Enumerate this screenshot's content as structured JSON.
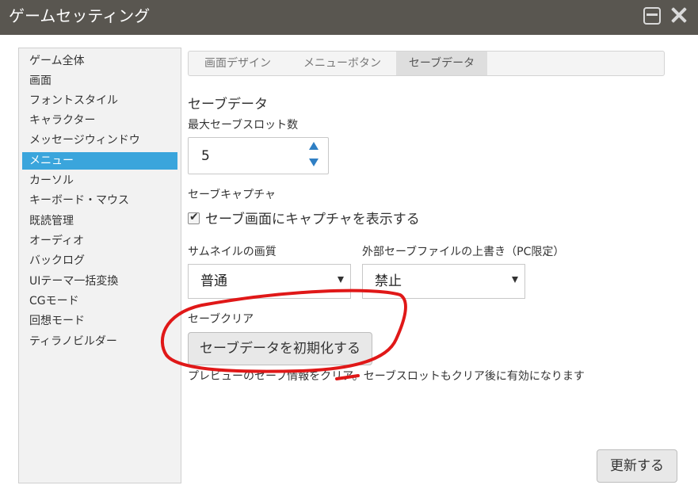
{
  "window": {
    "title": "ゲームセッティング",
    "minimize_icon": "minimize-icon",
    "close_icon": "close-icon"
  },
  "sidebar": {
    "items": [
      {
        "label": "ゲーム全体"
      },
      {
        "label": "画面"
      },
      {
        "label": "フォントスタイル"
      },
      {
        "label": "キャラクター"
      },
      {
        "label": "メッセージウィンドウ"
      },
      {
        "label": "メニュー",
        "active": true
      },
      {
        "label": "カーソル"
      },
      {
        "label": "キーボード・マウス"
      },
      {
        "label": "既読管理"
      },
      {
        "label": "オーディオ"
      },
      {
        "label": "バックログ"
      },
      {
        "label": "UIテーマ一括変換"
      },
      {
        "label": "CGモード"
      },
      {
        "label": "回想モード"
      },
      {
        "label": "ティラノビルダー"
      }
    ],
    "active_color": "#3aa5dc"
  },
  "tabs": [
    {
      "label": "画面デザイン"
    },
    {
      "label": "メニューボタン"
    },
    {
      "label": "セーブデータ",
      "active": true
    }
  ],
  "main": {
    "section_title": "セーブデータ",
    "max_slots_label": "最大セーブスロット数",
    "max_slots_value": "5",
    "capture_label": "セーブキャプチャ",
    "capture_checkbox_label": "セーブ画面にキャプチャを表示する",
    "capture_checked": true,
    "thumb_quality_label": "サムネイルの画質",
    "thumb_quality_value": "普通",
    "external_overwrite_label": "外部セーブファイルの上書き（PC限定）",
    "external_overwrite_value": "禁止",
    "clear_label": "セーブクリア",
    "clear_button": "セーブデータを初期化する",
    "clear_hint": "プレビューのセーブ情報をクリア。セーブスロットもクリア後に有効になります",
    "update_button": "更新する"
  },
  "colors": {
    "titlebar": "#595650",
    "spinner_arrow": "#2f7fc4",
    "annotation_stroke": "#e01818"
  }
}
